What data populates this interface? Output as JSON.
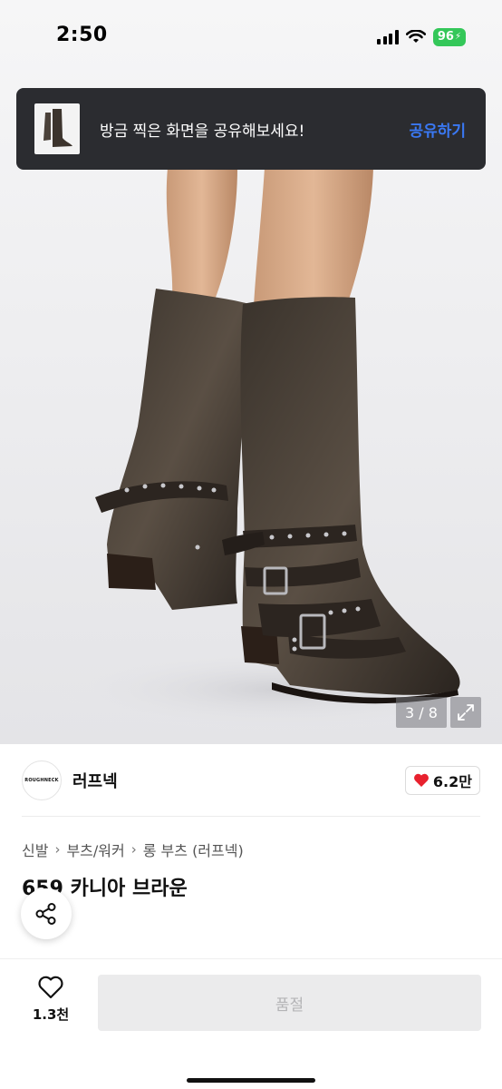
{
  "status_bar": {
    "time": "2:50",
    "battery": "96"
  },
  "toast": {
    "message": "방금 찍은 화면을 공유해보세요!",
    "action": "공유하기"
  },
  "gallery": {
    "counter": "3 / 8"
  },
  "brand": {
    "logo_text": "ROUGHNECK",
    "name": "러프넥",
    "likes": "6.2만"
  },
  "breadcrumb": [
    "신발",
    "부츠/워커",
    "롱 부츠 (러프넥)"
  ],
  "product": {
    "title": "659 카니아 브라운"
  },
  "bottom_bar": {
    "wish_count": "1.3천",
    "buy_label": "품절"
  },
  "colors": {
    "accent": "#3a78f2",
    "heart": "#e8212e",
    "toast_bg": "#2b2c30",
    "battery": "#34c759"
  }
}
